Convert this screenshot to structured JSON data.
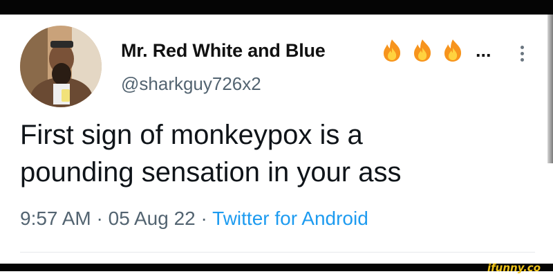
{
  "tweet": {
    "author": {
      "display_name": "Mr. Red White and Blue",
      "name_emojis": [
        "fire-icon",
        "fire-icon",
        "fire-icon"
      ],
      "name_truncation": "...",
      "handle": "@sharkguy726x2"
    },
    "text_line_1": "First sign of monkeypox is a",
    "text_line_2": "pounding sensation in your ass",
    "time": "9:57 AM",
    "separator": "·",
    "date": "05 Aug 22",
    "source": "Twitter for Android"
  },
  "watermark": "ifunny.co",
  "colors": {
    "text": "#0f1419",
    "secondary": "#536471",
    "link": "#1d9bf0",
    "watermark": "#f0c419"
  }
}
